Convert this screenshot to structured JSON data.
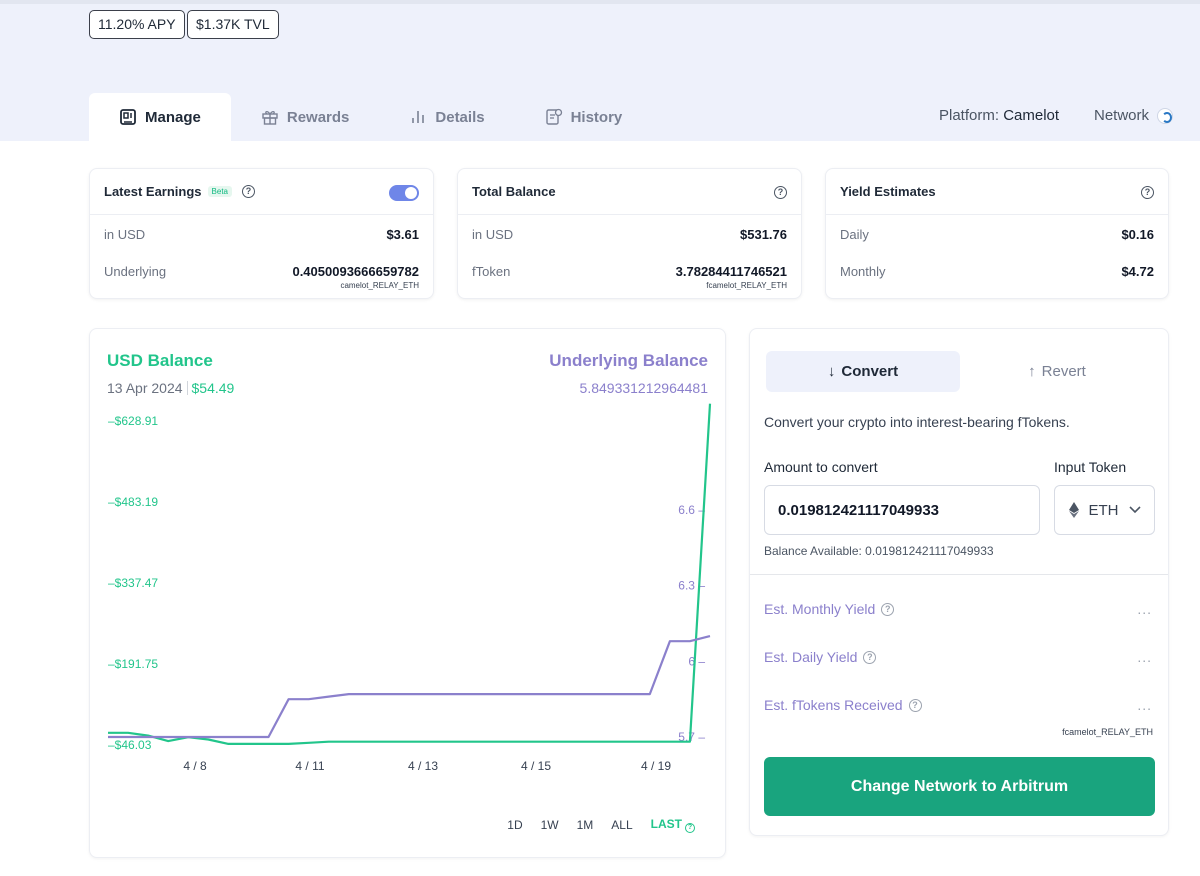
{
  "header": {
    "apy_chip": "11.20% APY",
    "tvl_chip": "$1.37K TVL",
    "tabs": [
      {
        "label": "Manage",
        "icon": "wallet-icon"
      },
      {
        "label": "Rewards",
        "icon": "gift-icon"
      },
      {
        "label": "Details",
        "icon": "bars-icon"
      },
      {
        "label": "History",
        "icon": "history-icon"
      }
    ],
    "platform_label": "Platform:",
    "platform_value": "Camelot",
    "network_label": "Network"
  },
  "cards": {
    "earnings": {
      "title": "Latest Earnings",
      "badge": "Beta",
      "rows": [
        {
          "label": "in USD",
          "value": "$3.61"
        },
        {
          "label": "Underlying",
          "value": "0.4050093666659782",
          "sub": "camelot_RELAY_ETH"
        }
      ]
    },
    "balance": {
      "title": "Total Balance",
      "rows": [
        {
          "label": "in USD",
          "value": "$531.76"
        },
        {
          "label": "fToken",
          "value": "3.78284411746521",
          "sub": "fcamelot_RELAY_ETH"
        }
      ]
    },
    "yield": {
      "title": "Yield Estimates",
      "rows": [
        {
          "label": "Daily",
          "value": "$0.16"
        },
        {
          "label": "Monthly",
          "value": "$4.72"
        }
      ]
    }
  },
  "chart": {
    "usd_title": "USD Balance",
    "date": "13 Apr 2024",
    "usd_value": "$54.49",
    "underlying_title": "Underlying Balance",
    "underlying_value": "5.849331212964481",
    "ranges": [
      "1D",
      "1W",
      "1M",
      "ALL",
      "LAST"
    ],
    "active_range": "LAST"
  },
  "chart_data": {
    "type": "line",
    "x_ticks": [
      "4 / 8",
      "4 / 11",
      "4 / 13",
      "4 / 15",
      "4 / 19"
    ],
    "y_left_ticks": [
      "$628.91",
      "$483.19",
      "$337.47",
      "$191.75",
      "$46.03"
    ],
    "y_right_ticks": [
      "6.6",
      "6.3",
      "6",
      "5.7"
    ],
    "series": [
      {
        "name": "USD Balance",
        "color": "#22c58b",
        "axis": "left",
        "values": [
          68,
          68,
          63,
          53,
          60,
          56,
          48,
          48,
          48,
          48,
          50,
          52,
          52,
          52,
          52,
          52,
          52,
          52,
          52,
          52,
          52,
          52,
          52,
          52,
          52,
          52,
          52,
          52,
          52,
          52,
          660
        ]
      },
      {
        "name": "Underlying Balance",
        "color": "#8b80cc",
        "axis": "right",
        "values": [
          5.7,
          5.7,
          5.7,
          5.7,
          5.7,
          5.7,
          5.7,
          5.7,
          5.7,
          5.85,
          5.85,
          5.86,
          5.87,
          5.87,
          5.87,
          5.87,
          5.87,
          5.87,
          5.87,
          5.87,
          5.87,
          5.87,
          5.87,
          5.87,
          5.87,
          5.87,
          5.87,
          5.87,
          6.08,
          6.08,
          6.1
        ]
      }
    ],
    "ylim_left": [
      46.03,
      628.91
    ],
    "ylim_right": [
      5.7,
      6.6
    ]
  },
  "convert": {
    "tab_convert": "Convert",
    "tab_revert": "Revert",
    "description": "Convert your crypto into interest-bearing fTokens.",
    "amount_label": "Amount to convert",
    "amount_value": "0.019812421117049933",
    "input_token_label": "Input Token",
    "token": "ETH",
    "balance_text": "Balance Available:  0.019812421117049933",
    "estimates": [
      {
        "label": "Est. Monthly Yield",
        "value": "..."
      },
      {
        "label": "Est. Daily Yield",
        "value": "..."
      },
      {
        "label": "Est. fTokens Received",
        "value": "..."
      }
    ],
    "ftoken_unit": "fcamelot_RELAY_ETH",
    "cta": "Change Network to Arbitrum"
  },
  "colors": {
    "usd": "#22c58b",
    "underlying": "#8b80cc",
    "cta": "#19a47e"
  }
}
